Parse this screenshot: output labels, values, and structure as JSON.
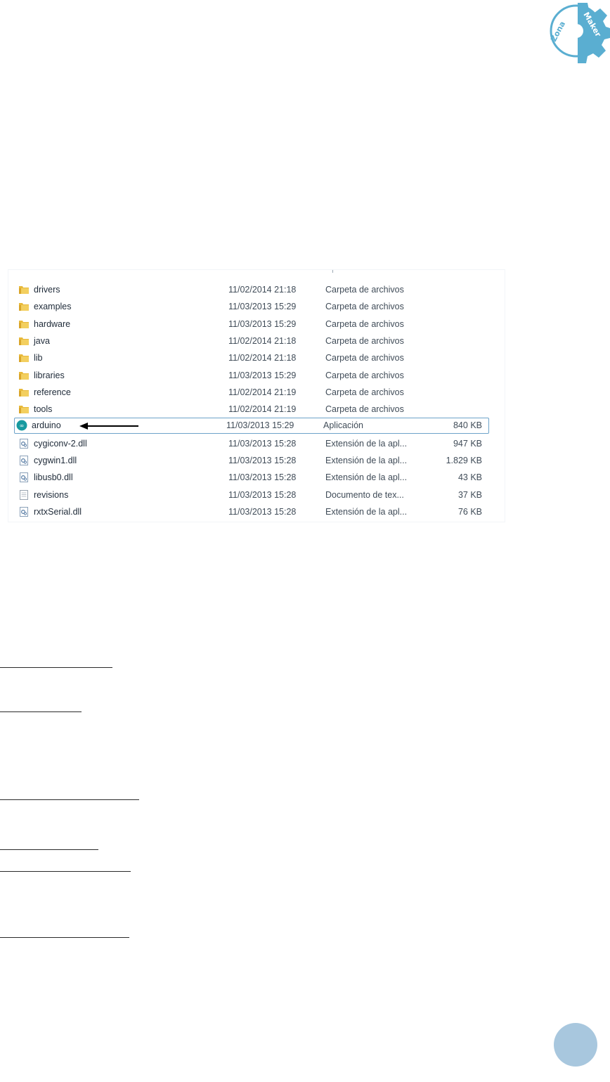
{
  "logo": {
    "text_line1": "Zona",
    "text_line2": "Maker",
    "color": "#5aaed1"
  },
  "explorer": {
    "files": [
      {
        "name": "drivers",
        "date": "11/02/2014 21:18",
        "type": "Carpeta de archivos",
        "size": "",
        "icon": "folder-icon"
      },
      {
        "name": "examples",
        "date": "11/03/2013 15:29",
        "type": "Carpeta de archivos",
        "size": "",
        "icon": "folder-icon"
      },
      {
        "name": "hardware",
        "date": "11/03/2013 15:29",
        "type": "Carpeta de archivos",
        "size": "",
        "icon": "folder-icon"
      },
      {
        "name": "java",
        "date": "11/02/2014 21:18",
        "type": "Carpeta de archivos",
        "size": "",
        "icon": "folder-icon"
      },
      {
        "name": "lib",
        "date": "11/02/2014 21:18",
        "type": "Carpeta de archivos",
        "size": "",
        "icon": "folder-icon"
      },
      {
        "name": "libraries",
        "date": "11/03/2013 15:29",
        "type": "Carpeta de archivos",
        "size": "",
        "icon": "folder-icon"
      },
      {
        "name": "reference",
        "date": "11/02/2014 21:19",
        "type": "Carpeta de archivos",
        "size": "",
        "icon": "folder-icon"
      },
      {
        "name": "tools",
        "date": "11/02/2014 21:19",
        "type": "Carpeta de archivos",
        "size": "",
        "icon": "folder-icon"
      },
      {
        "name": "arduino",
        "date": "11/03/2013 15:29",
        "type": "Aplicación",
        "size": "840 KB",
        "icon": "arduino-app-icon",
        "selected": true
      },
      {
        "name": "cygiconv-2.dll",
        "date": "11/03/2013 15:28",
        "type": "Extensión de la apl...",
        "size": "947 KB",
        "icon": "dll-file-icon"
      },
      {
        "name": "cygwin1.dll",
        "date": "11/03/2013 15:28",
        "type": "Extensión de la apl...",
        "size": "1.829 KB",
        "icon": "dll-file-icon"
      },
      {
        "name": "libusb0.dll",
        "date": "11/03/2013 15:28",
        "type": "Extensión de la apl...",
        "size": "43 KB",
        "icon": "dll-file-icon"
      },
      {
        "name": "revisions",
        "date": "11/03/2013 15:28",
        "type": "Documento de tex...",
        "size": "37 KB",
        "icon": "text-file-icon"
      },
      {
        "name": "rxtxSerial.dll",
        "date": "11/03/2013 15:28",
        "type": "Extensión de la apl...",
        "size": "76 KB",
        "icon": "dll-file-icon"
      }
    ]
  },
  "colors": {
    "folder": "#e8b93a",
    "selection_border": "#6da3c9",
    "arduino_teal": "#179aa0",
    "page_circle": "#a8c7de"
  }
}
